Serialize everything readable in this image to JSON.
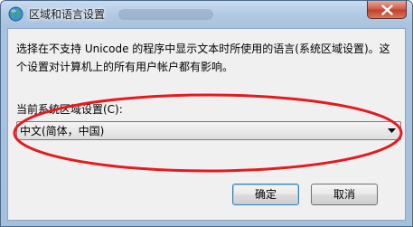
{
  "window": {
    "title": "区域和语言设置",
    "icon": "globe-icon",
    "close_icon": "close-icon"
  },
  "content": {
    "description": "选择在不支持 Unicode 的程序中显示文本时所使用的语言(系统区域设置)。这个设置对计算机上的所有用户帐户都有影响。",
    "locale_label": "当前系统区域设置(C):",
    "locale_value": "中文(简体，中国)"
  },
  "buttons": {
    "ok": "确定",
    "cancel": "取消"
  },
  "colors": {
    "annotation": "#e8191e",
    "close_button": "#c8432f"
  }
}
